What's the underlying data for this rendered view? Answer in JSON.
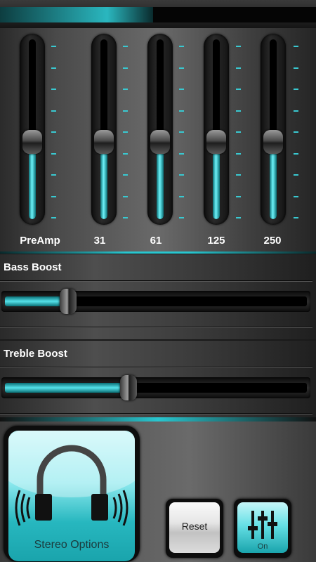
{
  "equalizer": {
    "bands": [
      {
        "label": "PreAmp",
        "level": 0.43
      },
      {
        "label": "31",
        "level": 0.43
      },
      {
        "label": "61",
        "level": 0.43
      },
      {
        "label": "125",
        "level": 0.43
      },
      {
        "label": "250",
        "level": 0.43
      }
    ]
  },
  "bass_boost": {
    "title": "Bass Boost",
    "level": 0.21
  },
  "treble_boost": {
    "title": "Treble Boost",
    "level": 0.41
  },
  "buttons": {
    "stereo_options": "Stereo Options",
    "reset": "Reset",
    "eq_toggle": "On"
  },
  "colors": {
    "accent": "#29c6cf"
  }
}
